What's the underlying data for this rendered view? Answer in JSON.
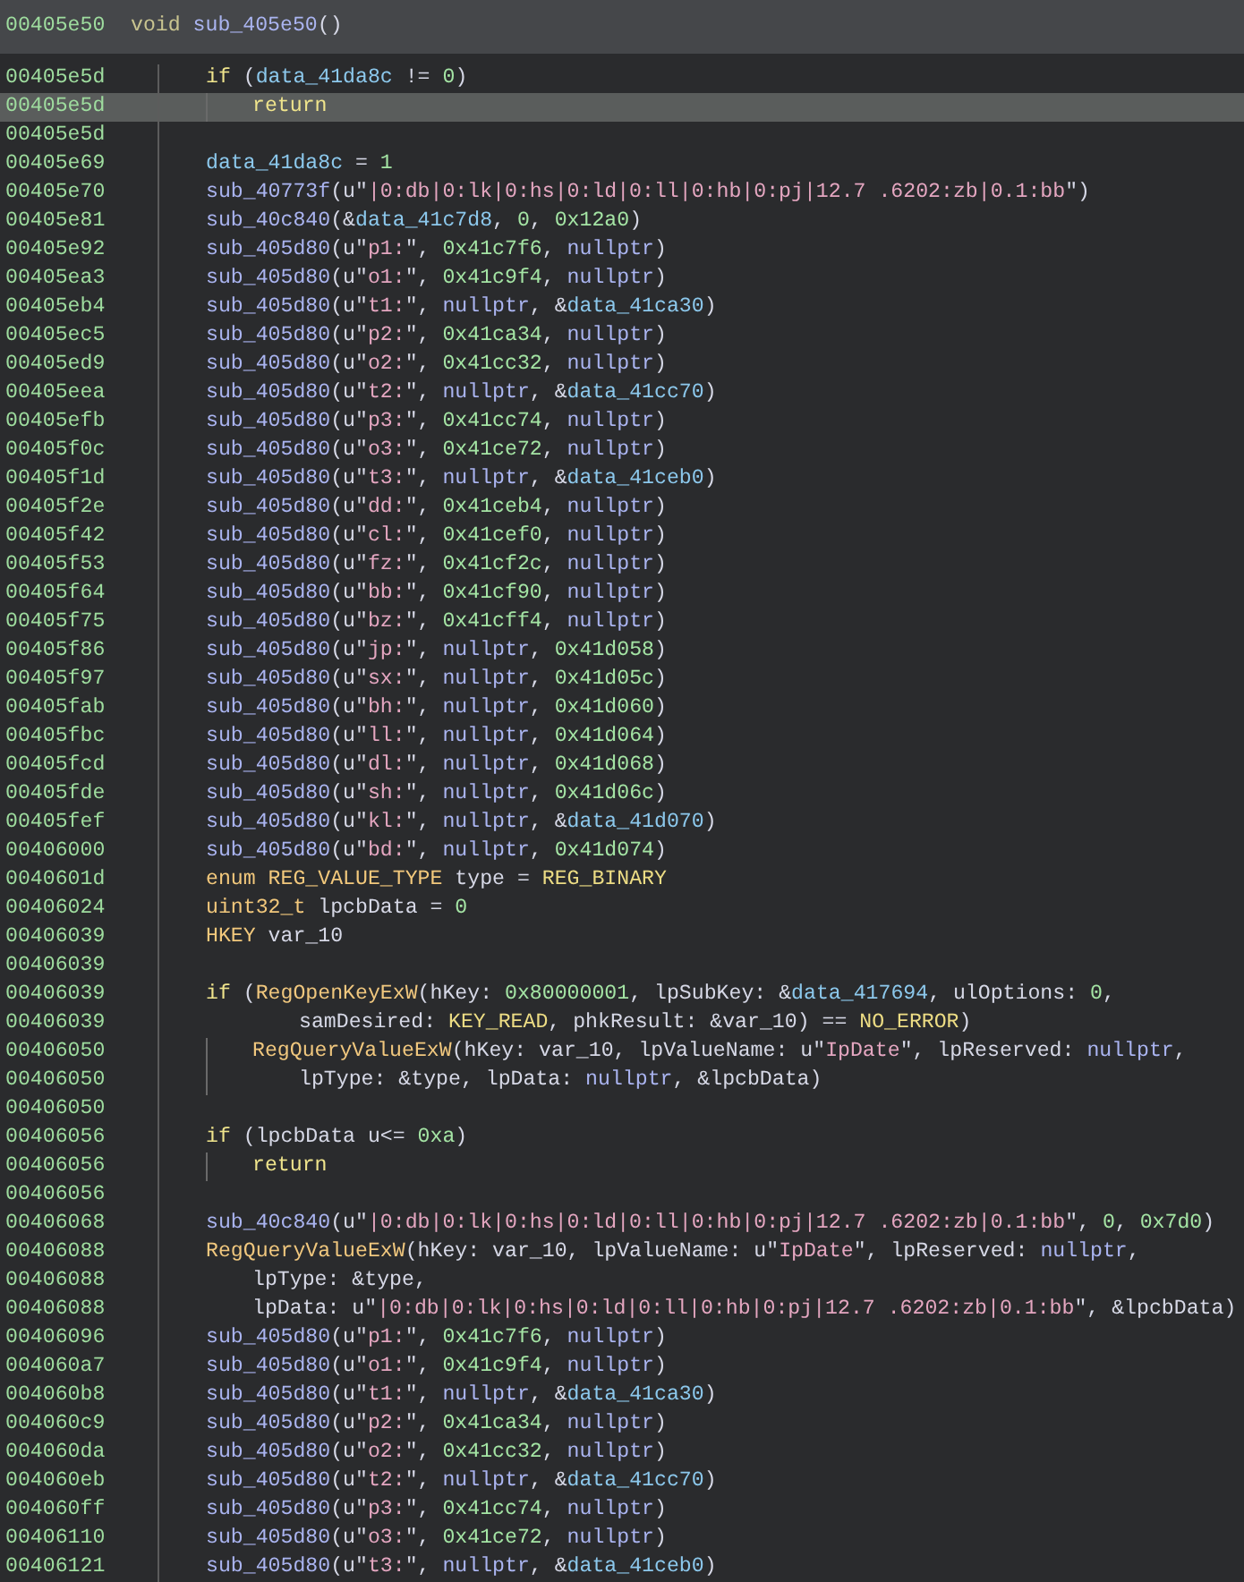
{
  "header": {
    "address": "00405e50",
    "signature": [
      {
        "kind": "type2",
        "text": "void"
      },
      {
        "kind": "fn",
        "text": "sub_405e50"
      },
      {
        "kind": "plain",
        "text": "()"
      }
    ]
  },
  "lines": [
    {
      "address": "00405e5d",
      "selected": false,
      "code": [
        {
          "kind": "kw",
          "text": "if"
        },
        {
          "kind": "plain",
          "text": " ("
        },
        {
          "kind": "data",
          "text": "data_41da8c"
        },
        {
          "kind": "plain",
          "text": " != "
        },
        {
          "kind": "num",
          "text": "0"
        },
        {
          "kind": "plain",
          "text": ")"
        }
      ],
      "children": [
        {
          "address": "00405e5d",
          "selected": true,
          "code": [
            {
              "kind": "kw",
              "text": "return"
            }
          ]
        }
      ]
    },
    {
      "address": "00405e5d",
      "selected": false
    },
    {
      "address": "00405e69",
      "selected": false,
      "code": [
        {
          "kind": "data",
          "text": "data_41da8c"
        },
        {
          "kind": "plain",
          "text": " = "
        },
        {
          "kind": "num",
          "text": "1"
        }
      ]
    },
    {
      "address": "00405e70",
      "selected": false,
      "code": [
        {
          "kind": "fn",
          "text": "sub_40773f"
        },
        {
          "kind": "plain",
          "text": "(u\""
        },
        {
          "kind": "str",
          "text": "|0:db|0:lk|0:hs|0:ld|0:ll|0:hb|0:pj|12.7 .6202:zb|0.1:bb"
        },
        {
          "kind": "plain",
          "text": "\")"
        }
      ]
    },
    {
      "address": "00405e81",
      "selected": false,
      "code": [
        {
          "kind": "fn",
          "text": "sub_40c840"
        },
        {
          "kind": "plain",
          "text": "(&"
        },
        {
          "kind": "data",
          "text": "data_41c7d8"
        },
        {
          "kind": "plain",
          "text": ", "
        },
        {
          "kind": "num",
          "text": "0"
        },
        {
          "kind": "plain",
          "text": ", "
        },
        {
          "kind": "num",
          "text": "0x12a0"
        },
        {
          "kind": "plain",
          "text": ")"
        }
      ]
    },
    {
      "address": "00405e92",
      "selected": false,
      "code": [
        {
          "kind": "fn",
          "text": "sub_405d80"
        },
        {
          "kind": "plain",
          "text": "(u\""
        },
        {
          "kind": "str",
          "text": "p1:"
        },
        {
          "kind": "plain",
          "text": "\", "
        },
        {
          "kind": "num",
          "text": "0x41c7f6"
        },
        {
          "kind": "plain",
          "text": ", "
        },
        {
          "kind": "null",
          "text": "nullptr"
        },
        {
          "kind": "plain",
          "text": ")"
        }
      ]
    },
    {
      "address": "00405ea3",
      "selected": false,
      "code": [
        {
          "kind": "fn",
          "text": "sub_405d80"
        },
        {
          "kind": "plain",
          "text": "(u\""
        },
        {
          "kind": "str",
          "text": "o1:"
        },
        {
          "kind": "plain",
          "text": "\", "
        },
        {
          "kind": "num",
          "text": "0x41c9f4"
        },
        {
          "kind": "plain",
          "text": ", "
        },
        {
          "kind": "null",
          "text": "nullptr"
        },
        {
          "kind": "plain",
          "text": ")"
        }
      ]
    },
    {
      "address": "00405eb4",
      "selected": false,
      "code": [
        {
          "kind": "fn",
          "text": "sub_405d80"
        },
        {
          "kind": "plain",
          "text": "(u\""
        },
        {
          "kind": "str",
          "text": "t1:"
        },
        {
          "kind": "plain",
          "text": "\", "
        },
        {
          "kind": "null",
          "text": "nullptr"
        },
        {
          "kind": "plain",
          "text": ", &"
        },
        {
          "kind": "data",
          "text": "data_41ca30"
        },
        {
          "kind": "plain",
          "text": ")"
        }
      ]
    },
    {
      "address": "00405ec5",
      "selected": false,
      "code": [
        {
          "kind": "fn",
          "text": "sub_405d80"
        },
        {
          "kind": "plain",
          "text": "(u\""
        },
        {
          "kind": "str",
          "text": "p2:"
        },
        {
          "kind": "plain",
          "text": "\", "
        },
        {
          "kind": "num",
          "text": "0x41ca34"
        },
        {
          "kind": "plain",
          "text": ", "
        },
        {
          "kind": "null",
          "text": "nullptr"
        },
        {
          "kind": "plain",
          "text": ")"
        }
      ]
    },
    {
      "address": "00405ed9",
      "selected": false,
      "code": [
        {
          "kind": "fn",
          "text": "sub_405d80"
        },
        {
          "kind": "plain",
          "text": "(u\""
        },
        {
          "kind": "str",
          "text": "o2:"
        },
        {
          "kind": "plain",
          "text": "\", "
        },
        {
          "kind": "num",
          "text": "0x41cc32"
        },
        {
          "kind": "plain",
          "text": ", "
        },
        {
          "kind": "null",
          "text": "nullptr"
        },
        {
          "kind": "plain",
          "text": ")"
        }
      ]
    },
    {
      "address": "00405eea",
      "selected": false,
      "code": [
        {
          "kind": "fn",
          "text": "sub_405d80"
        },
        {
          "kind": "plain",
          "text": "(u\""
        },
        {
          "kind": "str",
          "text": "t2:"
        },
        {
          "kind": "plain",
          "text": "\", "
        },
        {
          "kind": "null",
          "text": "nullptr"
        },
        {
          "kind": "plain",
          "text": ", &"
        },
        {
          "kind": "data",
          "text": "data_41cc70"
        },
        {
          "kind": "plain",
          "text": ")"
        }
      ]
    },
    {
      "address": "00405efb",
      "selected": false,
      "code": [
        {
          "kind": "fn",
          "text": "sub_405d80"
        },
        {
          "kind": "plain",
          "text": "(u\""
        },
        {
          "kind": "str",
          "text": "p3:"
        },
        {
          "kind": "plain",
          "text": "\", "
        },
        {
          "kind": "num",
          "text": "0x41cc74"
        },
        {
          "kind": "plain",
          "text": ", "
        },
        {
          "kind": "null",
          "text": "nullptr"
        },
        {
          "kind": "plain",
          "text": ")"
        }
      ]
    },
    {
      "address": "00405f0c",
      "selected": false,
      "code": [
        {
          "kind": "fn",
          "text": "sub_405d80"
        },
        {
          "kind": "plain",
          "text": "(u\""
        },
        {
          "kind": "str",
          "text": "o3:"
        },
        {
          "kind": "plain",
          "text": "\", "
        },
        {
          "kind": "num",
          "text": "0x41ce72"
        },
        {
          "kind": "plain",
          "text": ", "
        },
        {
          "kind": "null",
          "text": "nullptr"
        },
        {
          "kind": "plain",
          "text": ")"
        }
      ]
    },
    {
      "address": "00405f1d",
      "selected": false,
      "code": [
        {
          "kind": "fn",
          "text": "sub_405d80"
        },
        {
          "kind": "plain",
          "text": "(u\""
        },
        {
          "kind": "str",
          "text": "t3:"
        },
        {
          "kind": "plain",
          "text": "\", "
        },
        {
          "kind": "null",
          "text": "nullptr"
        },
        {
          "kind": "plain",
          "text": ", &"
        },
        {
          "kind": "data",
          "text": "data_41ceb0"
        },
        {
          "kind": "plain",
          "text": ")"
        }
      ]
    },
    {
      "address": "00405f2e",
      "selected": false,
      "code": [
        {
          "kind": "fn",
          "text": "sub_405d80"
        },
        {
          "kind": "plain",
          "text": "(u\""
        },
        {
          "kind": "str",
          "text": "dd:"
        },
        {
          "kind": "plain",
          "text": "\", "
        },
        {
          "kind": "num",
          "text": "0x41ceb4"
        },
        {
          "kind": "plain",
          "text": ", "
        },
        {
          "kind": "null",
          "text": "nullptr"
        },
        {
          "kind": "plain",
          "text": ")"
        }
      ]
    },
    {
      "address": "00405f42",
      "selected": false,
      "code": [
        {
          "kind": "fn",
          "text": "sub_405d80"
        },
        {
          "kind": "plain",
          "text": "(u\""
        },
        {
          "kind": "str",
          "text": "cl:"
        },
        {
          "kind": "plain",
          "text": "\", "
        },
        {
          "kind": "num",
          "text": "0x41cef0"
        },
        {
          "kind": "plain",
          "text": ", "
        },
        {
          "kind": "null",
          "text": "nullptr"
        },
        {
          "kind": "plain",
          "text": ")"
        }
      ]
    },
    {
      "address": "00405f53",
      "selected": false,
      "code": [
        {
          "kind": "fn",
          "text": "sub_405d80"
        },
        {
          "kind": "plain",
          "text": "(u\""
        },
        {
          "kind": "str",
          "text": "fz:"
        },
        {
          "kind": "plain",
          "text": "\", "
        },
        {
          "kind": "num",
          "text": "0x41cf2c"
        },
        {
          "kind": "plain",
          "text": ", "
        },
        {
          "kind": "null",
          "text": "nullptr"
        },
        {
          "kind": "plain",
          "text": ")"
        }
      ]
    },
    {
      "address": "00405f64",
      "selected": false,
      "code": [
        {
          "kind": "fn",
          "text": "sub_405d80"
        },
        {
          "kind": "plain",
          "text": "(u\""
        },
        {
          "kind": "str",
          "text": "bb:"
        },
        {
          "kind": "plain",
          "text": "\", "
        },
        {
          "kind": "num",
          "text": "0x41cf90"
        },
        {
          "kind": "plain",
          "text": ", "
        },
        {
          "kind": "null",
          "text": "nullptr"
        },
        {
          "kind": "plain",
          "text": ")"
        }
      ]
    },
    {
      "address": "00405f75",
      "selected": false,
      "code": [
        {
          "kind": "fn",
          "text": "sub_405d80"
        },
        {
          "kind": "plain",
          "text": "(u\""
        },
        {
          "kind": "str",
          "text": "bz:"
        },
        {
          "kind": "plain",
          "text": "\", "
        },
        {
          "kind": "num",
          "text": "0x41cff4"
        },
        {
          "kind": "plain",
          "text": ", "
        },
        {
          "kind": "null",
          "text": "nullptr"
        },
        {
          "kind": "plain",
          "text": ")"
        }
      ]
    },
    {
      "address": "00405f86",
      "selected": false,
      "code": [
        {
          "kind": "fn",
          "text": "sub_405d80"
        },
        {
          "kind": "plain",
          "text": "(u\""
        },
        {
          "kind": "str",
          "text": "jp:"
        },
        {
          "kind": "plain",
          "text": "\", "
        },
        {
          "kind": "null",
          "text": "nullptr"
        },
        {
          "kind": "plain",
          "text": ", "
        },
        {
          "kind": "num",
          "text": "0x41d058"
        },
        {
          "kind": "plain",
          "text": ")"
        }
      ]
    },
    {
      "address": "00405f97",
      "selected": false,
      "code": [
        {
          "kind": "fn",
          "text": "sub_405d80"
        },
        {
          "kind": "plain",
          "text": "(u\""
        },
        {
          "kind": "str",
          "text": "sx:"
        },
        {
          "kind": "plain",
          "text": "\", "
        },
        {
          "kind": "null",
          "text": "nullptr"
        },
        {
          "kind": "plain",
          "text": ", "
        },
        {
          "kind": "num",
          "text": "0x41d05c"
        },
        {
          "kind": "plain",
          "text": ")"
        }
      ]
    },
    {
      "address": "00405fab",
      "selected": false,
      "code": [
        {
          "kind": "fn",
          "text": "sub_405d80"
        },
        {
          "kind": "plain",
          "text": "(u\""
        },
        {
          "kind": "str",
          "text": "bh:"
        },
        {
          "kind": "plain",
          "text": "\", "
        },
        {
          "kind": "null",
          "text": "nullptr"
        },
        {
          "kind": "plain",
          "text": ", "
        },
        {
          "kind": "num",
          "text": "0x41d060"
        },
        {
          "kind": "plain",
          "text": ")"
        }
      ]
    },
    {
      "address": "00405fbc",
      "selected": false,
      "code": [
        {
          "kind": "fn",
          "text": "sub_405d80"
        },
        {
          "kind": "plain",
          "text": "(u\""
        },
        {
          "kind": "str",
          "text": "ll:"
        },
        {
          "kind": "plain",
          "text": "\", "
        },
        {
          "kind": "null",
          "text": "nullptr"
        },
        {
          "kind": "plain",
          "text": ", "
        },
        {
          "kind": "num",
          "text": "0x41d064"
        },
        {
          "kind": "plain",
          "text": ")"
        }
      ]
    },
    {
      "address": "00405fcd",
      "selected": false,
      "code": [
        {
          "kind": "fn",
          "text": "sub_405d80"
        },
        {
          "kind": "plain",
          "text": "(u\""
        },
        {
          "kind": "str",
          "text": "dl:"
        },
        {
          "kind": "plain",
          "text": "\", "
        },
        {
          "kind": "null",
          "text": "nullptr"
        },
        {
          "kind": "plain",
          "text": ", "
        },
        {
          "kind": "num",
          "text": "0x41d068"
        },
        {
          "kind": "plain",
          "text": ")"
        }
      ]
    },
    {
      "address": "00405fde",
      "selected": false,
      "code": [
        {
          "kind": "fn",
          "text": "sub_405d80"
        },
        {
          "kind": "plain",
          "text": "(u\""
        },
        {
          "kind": "str",
          "text": "sh:"
        },
        {
          "kind": "plain",
          "text": "\", "
        },
        {
          "kind": "null",
          "text": "nullptr"
        },
        {
          "kind": "plain",
          "text": ", "
        },
        {
          "kind": "num",
          "text": "0x41d06c"
        },
        {
          "kind": "plain",
          "text": ")"
        }
      ]
    },
    {
      "address": "00405fef",
      "selected": false,
      "code": [
        {
          "kind": "fn",
          "text": "sub_405d80"
        },
        {
          "kind": "plain",
          "text": "(u\""
        },
        {
          "kind": "str",
          "text": "kl:"
        },
        {
          "kind": "plain",
          "text": "\", "
        },
        {
          "kind": "null",
          "text": "nullptr"
        },
        {
          "kind": "plain",
          "text": ", &"
        },
        {
          "kind": "data",
          "text": "data_41d070"
        },
        {
          "kind": "plain",
          "text": ")"
        }
      ]
    },
    {
      "address": "00406000",
      "selected": false,
      "code": [
        {
          "kind": "fn",
          "text": "sub_405d80"
        },
        {
          "kind": "plain",
          "text": "(u\""
        },
        {
          "kind": "str",
          "text": "bd:"
        },
        {
          "kind": "plain",
          "text": "\", "
        },
        {
          "kind": "null",
          "text": "nullptr"
        },
        {
          "kind": "plain",
          "text": ", "
        },
        {
          "kind": "num",
          "text": "0x41d074"
        },
        {
          "kind": "plain",
          "text": ")"
        }
      ]
    },
    {
      "address": "0040601d",
      "selected": false,
      "code": [
        {
          "kind": "type",
          "text": "enum REG_VALUE_TYPE"
        },
        {
          "kind": "plain",
          "text": " type = "
        },
        {
          "kind": "const",
          "text": "REG_BINARY"
        }
      ]
    },
    {
      "address": "00406024",
      "selected": false,
      "code": [
        {
          "kind": "type",
          "text": "uint32_t"
        },
        {
          "kind": "plain",
          "text": " lpcbData = "
        },
        {
          "kind": "num",
          "text": "0"
        }
      ]
    },
    {
      "address": "00406039",
      "selected": false,
      "code": [
        {
          "kind": "type",
          "text": "HKEY"
        },
        {
          "kind": "plain",
          "text": " var_10"
        }
      ]
    },
    {
      "address": "00406039",
      "selected": false
    },
    {
      "address": "00406039",
      "selected": false,
      "code": [
        {
          "kind": "kw",
          "text": "if"
        },
        {
          "kind": "plain",
          "text": " ("
        },
        {
          "kind": "fn2",
          "text": "RegOpenKeyExW"
        },
        {
          "kind": "plain",
          "text": "(hKey: "
        },
        {
          "kind": "num",
          "text": "0x80000001"
        },
        {
          "kind": "plain",
          "text": ", lpSubKey: &"
        },
        {
          "kind": "data",
          "text": "data_417694"
        },
        {
          "kind": "plain",
          "text": ", ulOptions: "
        },
        {
          "kind": "num",
          "text": "0"
        },
        {
          "kind": "plain",
          "text": ","
        }
      ],
      "continued": [
        {
          "address": "00406039",
          "selected": false,
          "code": [
            {
              "kind": "plain",
              "text": "samDesired: "
            },
            {
              "kind": "const",
              "text": "KEY_READ"
            },
            {
              "kind": "plain",
              "text": ", phkResult: &var_10) == "
            },
            {
              "kind": "const",
              "text": "NO_ERROR"
            },
            {
              "kind": "plain",
              "text": ")"
            }
          ]
        }
      ],
      "children": [
        {
          "address": "00406050",
          "selected": false,
          "code": [
            {
              "kind": "fn2",
              "text": "RegQueryValueExW"
            },
            {
              "kind": "plain",
              "text": "(hKey: var_10, lpValueName: u\""
            },
            {
              "kind": "str",
              "text": "IpDate"
            },
            {
              "kind": "plain",
              "text": "\", lpReserved: "
            },
            {
              "kind": "null",
              "text": "nullptr"
            },
            {
              "kind": "plain",
              "text": ","
            }
          ],
          "continued": [
            {
              "address": "00406050",
              "selected": false,
              "code": [
                {
                  "kind": "plain",
                  "text": "lpType: &type, lpData: "
                },
                {
                  "kind": "null",
                  "text": "nullptr"
                },
                {
                  "kind": "plain",
                  "text": ", &lpcbData)"
                }
              ]
            }
          ]
        }
      ]
    },
    {
      "address": "00406050",
      "selected": false
    },
    {
      "address": "00406056",
      "selected": false,
      "code": [
        {
          "kind": "kw",
          "text": "if"
        },
        {
          "kind": "plain",
          "text": " (lpcbData u<= "
        },
        {
          "kind": "num",
          "text": "0xa"
        },
        {
          "kind": "plain",
          "text": ")"
        }
      ],
      "children": [
        {
          "address": "00406056",
          "selected": false,
          "code": [
            {
              "kind": "kw",
              "text": "return"
            }
          ]
        }
      ]
    },
    {
      "address": "00406056",
      "selected": false
    },
    {
      "address": "00406068",
      "selected": false,
      "code": [
        {
          "kind": "fn",
          "text": "sub_40c840"
        },
        {
          "kind": "plain",
          "text": "(u\""
        },
        {
          "kind": "str",
          "text": "|0:db|0:lk|0:hs|0:ld|0:ll|0:hb|0:pj|12.7 .6202:zb|0.1:bb"
        },
        {
          "kind": "plain",
          "text": "\", "
        },
        {
          "kind": "num",
          "text": "0"
        },
        {
          "kind": "plain",
          "text": ", "
        },
        {
          "kind": "num",
          "text": "0x7d0"
        },
        {
          "kind": "plain",
          "text": ")"
        }
      ]
    },
    {
      "address": "00406088",
      "selected": false,
      "code": [
        {
          "kind": "fn2",
          "text": "RegQueryValueExW"
        },
        {
          "kind": "plain",
          "text": "(hKey: var_10, lpValueName: u\""
        },
        {
          "kind": "str",
          "text": "IpDate"
        },
        {
          "kind": "plain",
          "text": "\", lpReserved: "
        },
        {
          "kind": "null",
          "text": "nullptr"
        },
        {
          "kind": "plain",
          "text": ","
        }
      ],
      "continued": [
        {
          "address": "00406088",
          "selected": false,
          "code": [
            {
              "kind": "plain",
              "text": "lpType: &type,"
            }
          ]
        },
        {
          "address": "00406088",
          "selected": false,
          "code": [
            {
              "kind": "plain",
              "text": "lpData: u\""
            },
            {
              "kind": "str",
              "text": "|0:db|0:lk|0:hs|0:ld|0:ll|0:hb|0:pj|12.7 .6202:zb|0.1:bb"
            },
            {
              "kind": "plain",
              "text": "\", &lpcbData)"
            }
          ]
        }
      ]
    },
    {
      "address": "00406096",
      "selected": false,
      "code": [
        {
          "kind": "fn",
          "text": "sub_405d80"
        },
        {
          "kind": "plain",
          "text": "(u\""
        },
        {
          "kind": "str",
          "text": "p1:"
        },
        {
          "kind": "plain",
          "text": "\", "
        },
        {
          "kind": "num",
          "text": "0x41c7f6"
        },
        {
          "kind": "plain",
          "text": ", "
        },
        {
          "kind": "null",
          "text": "nullptr"
        },
        {
          "kind": "plain",
          "text": ")"
        }
      ]
    },
    {
      "address": "004060a7",
      "selected": false,
      "code": [
        {
          "kind": "fn",
          "text": "sub_405d80"
        },
        {
          "kind": "plain",
          "text": "(u\""
        },
        {
          "kind": "str",
          "text": "o1:"
        },
        {
          "kind": "plain",
          "text": "\", "
        },
        {
          "kind": "num",
          "text": "0x41c9f4"
        },
        {
          "kind": "plain",
          "text": ", "
        },
        {
          "kind": "null",
          "text": "nullptr"
        },
        {
          "kind": "plain",
          "text": ")"
        }
      ]
    },
    {
      "address": "004060b8",
      "selected": false,
      "code": [
        {
          "kind": "fn",
          "text": "sub_405d80"
        },
        {
          "kind": "plain",
          "text": "(u\""
        },
        {
          "kind": "str",
          "text": "t1:"
        },
        {
          "kind": "plain",
          "text": "\", "
        },
        {
          "kind": "null",
          "text": "nullptr"
        },
        {
          "kind": "plain",
          "text": ", &"
        },
        {
          "kind": "data",
          "text": "data_41ca30"
        },
        {
          "kind": "plain",
          "text": ")"
        }
      ]
    },
    {
      "address": "004060c9",
      "selected": false,
      "code": [
        {
          "kind": "fn",
          "text": "sub_405d80"
        },
        {
          "kind": "plain",
          "text": "(u\""
        },
        {
          "kind": "str",
          "text": "p2:"
        },
        {
          "kind": "plain",
          "text": "\", "
        },
        {
          "kind": "num",
          "text": "0x41ca34"
        },
        {
          "kind": "plain",
          "text": ", "
        },
        {
          "kind": "null",
          "text": "nullptr"
        },
        {
          "kind": "plain",
          "text": ")"
        }
      ]
    },
    {
      "address": "004060da",
      "selected": false,
      "code": [
        {
          "kind": "fn",
          "text": "sub_405d80"
        },
        {
          "kind": "plain",
          "text": "(u\""
        },
        {
          "kind": "str",
          "text": "o2:"
        },
        {
          "kind": "plain",
          "text": "\", "
        },
        {
          "kind": "num",
          "text": "0x41cc32"
        },
        {
          "kind": "plain",
          "text": ", "
        },
        {
          "kind": "null",
          "text": "nullptr"
        },
        {
          "kind": "plain",
          "text": ")"
        }
      ]
    },
    {
      "address": "004060eb",
      "selected": false,
      "code": [
        {
          "kind": "fn",
          "text": "sub_405d80"
        },
        {
          "kind": "plain",
          "text": "(u\""
        },
        {
          "kind": "str",
          "text": "t2:"
        },
        {
          "kind": "plain",
          "text": "\", "
        },
        {
          "kind": "null",
          "text": "nullptr"
        },
        {
          "kind": "plain",
          "text": ", &"
        },
        {
          "kind": "data",
          "text": "data_41cc70"
        },
        {
          "kind": "plain",
          "text": ")"
        }
      ]
    },
    {
      "address": "004060ff",
      "selected": false,
      "code": [
        {
          "kind": "fn",
          "text": "sub_405d80"
        },
        {
          "kind": "plain",
          "text": "(u\""
        },
        {
          "kind": "str",
          "text": "p3:"
        },
        {
          "kind": "plain",
          "text": "\", "
        },
        {
          "kind": "num",
          "text": "0x41cc74"
        },
        {
          "kind": "plain",
          "text": ", "
        },
        {
          "kind": "null",
          "text": "nullptr"
        },
        {
          "kind": "plain",
          "text": ")"
        }
      ]
    },
    {
      "address": "00406110",
      "selected": false,
      "code": [
        {
          "kind": "fn",
          "text": "sub_405d80"
        },
        {
          "kind": "plain",
          "text": "(u\""
        },
        {
          "kind": "str",
          "text": "o3:"
        },
        {
          "kind": "plain",
          "text": "\", "
        },
        {
          "kind": "num",
          "text": "0x41ce72"
        },
        {
          "kind": "plain",
          "text": ", "
        },
        {
          "kind": "null",
          "text": "nullptr"
        },
        {
          "kind": "plain",
          "text": ")"
        }
      ]
    },
    {
      "address": "00406121",
      "selected": false,
      "code": [
        {
          "kind": "fn",
          "text": "sub_405d80"
        },
        {
          "kind": "plain",
          "text": "(u\""
        },
        {
          "kind": "str",
          "text": "t3:"
        },
        {
          "kind": "plain",
          "text": "\", "
        },
        {
          "kind": "null",
          "text": "nullptr"
        },
        {
          "kind": "plain",
          "text": ", &"
        },
        {
          "kind": "data",
          "text": "data_41ceb0"
        },
        {
          "kind": "plain",
          "text": ")"
        }
      ]
    }
  ]
}
